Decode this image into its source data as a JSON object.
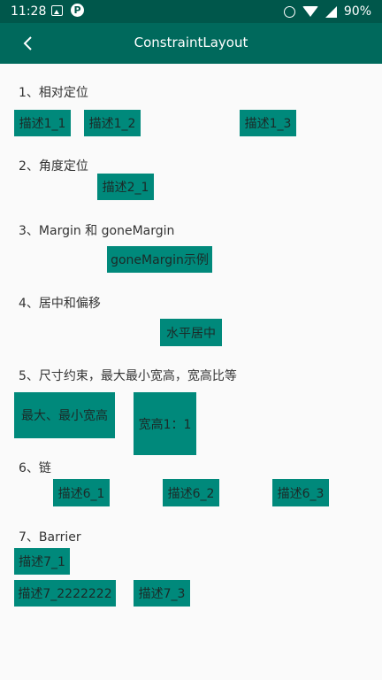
{
  "status_bar": {
    "time": "11:28",
    "battery": "90%",
    "icons": [
      "image-icon",
      "p-app-icon",
      "alarm-icon",
      "wifi-icon",
      "signal-icon"
    ]
  },
  "toolbar": {
    "title": "ConstraintLayout",
    "back_icon": "back-arrow-icon"
  },
  "sections": {
    "s1": "1、相对定位",
    "s2": "2、角度定位",
    "s3": "3、Margin 和 goneMargin",
    "s4": "4、居中和偏移",
    "s5": "5、尺寸约束，最大最小宽高，宽高比等",
    "s6": "6、链",
    "s7": "7、Barrier"
  },
  "boxes": {
    "b1_1": "描述1_1",
    "b1_2": "描述1_2",
    "b1_3": "描述1_3",
    "b2_1": "描述2_1",
    "b3_1": "goneMargin示例",
    "b4_1": "水平居中",
    "b5_1": "最大、最小宽高",
    "b5_2": "宽高1：1",
    "b6_1": "描述6_1",
    "b6_2": "描述6_2",
    "b6_3": "描述6_3",
    "b7_1": "描述7_1",
    "b7_2": "描述7_2222222",
    "b7_3": "描述7_3"
  },
  "colors": {
    "status_bar": "#00574b",
    "toolbar": "#00695c",
    "box": "#00897b",
    "background": "#fafafa"
  }
}
